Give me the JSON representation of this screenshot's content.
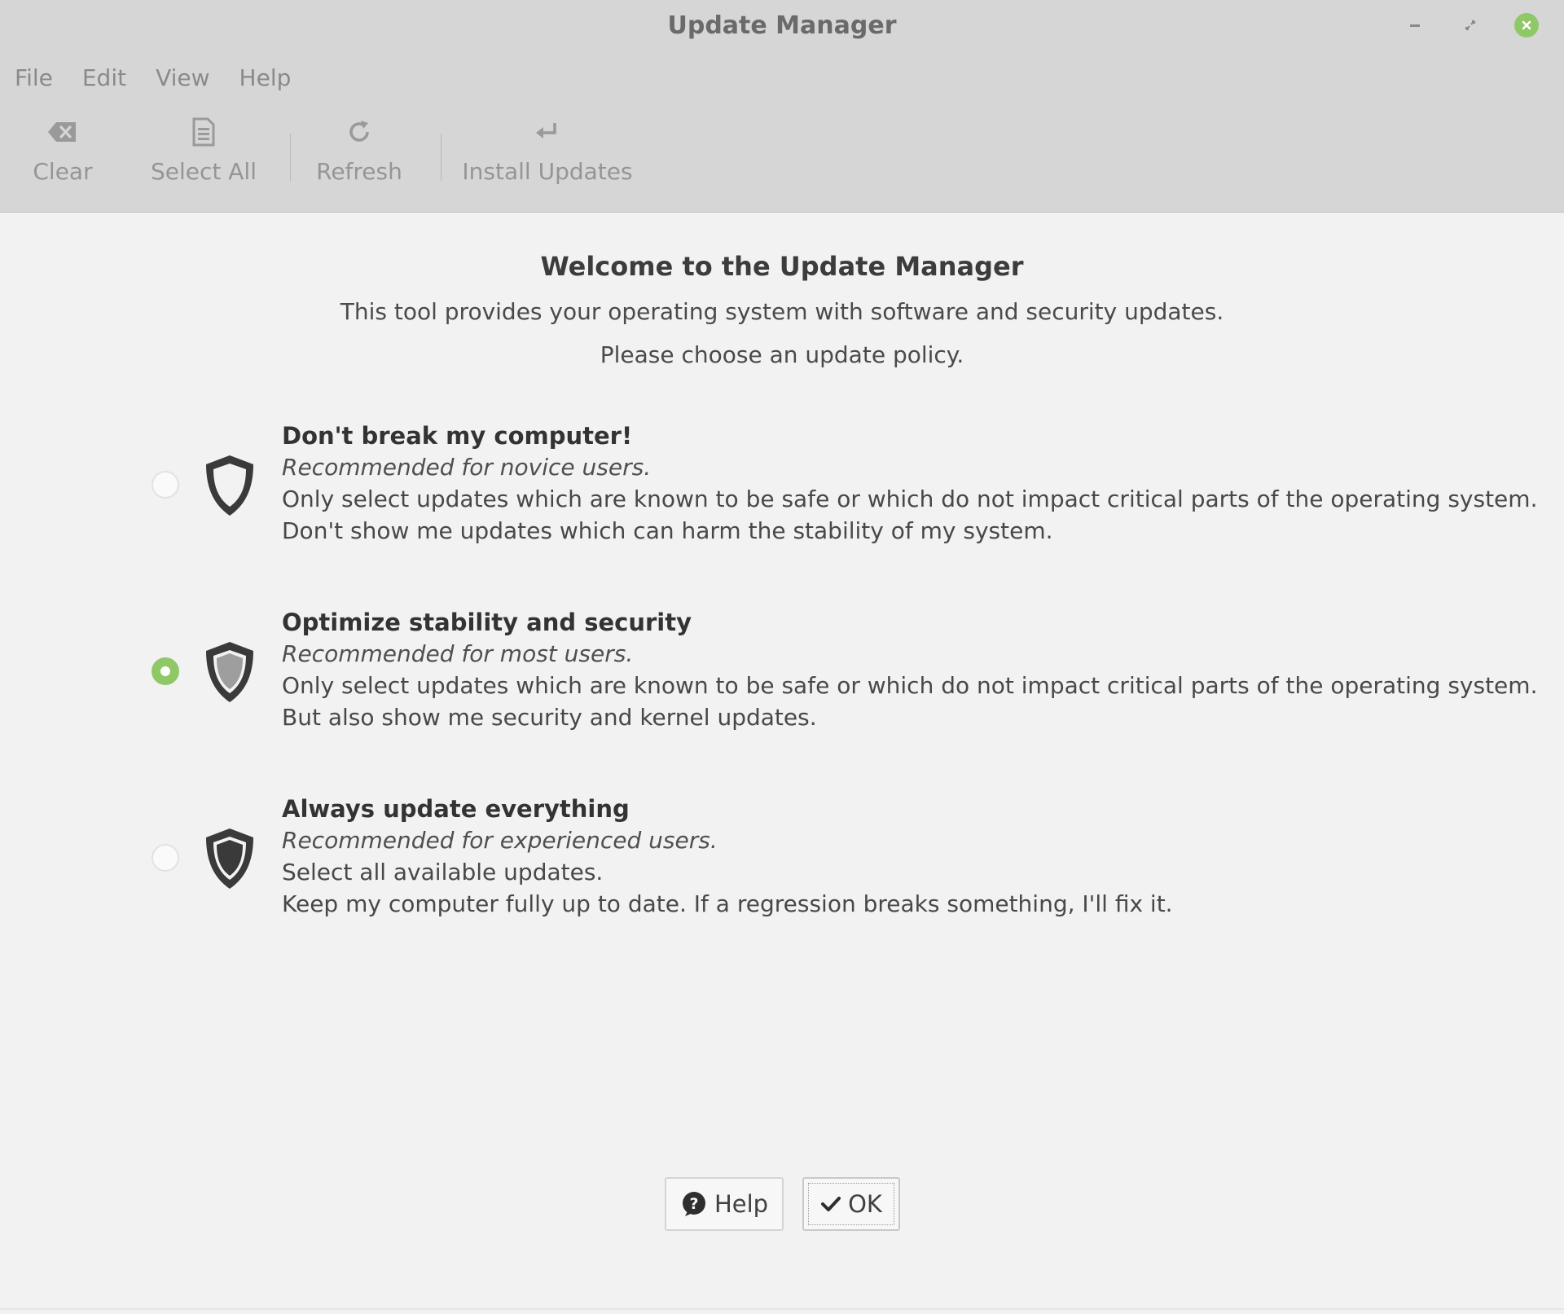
{
  "window": {
    "title": "Update Manager"
  },
  "menu": {
    "items": [
      {
        "label": "File"
      },
      {
        "label": "Edit"
      },
      {
        "label": "View"
      },
      {
        "label": "Help"
      }
    ]
  },
  "toolbar": {
    "clear": {
      "label": "Clear",
      "icon": "backspace-icon"
    },
    "select_all": {
      "label": "Select All",
      "icon": "document-icon"
    },
    "refresh": {
      "label": "Refresh",
      "icon": "refresh-icon"
    },
    "install_updates": {
      "label": "Install Updates",
      "icon": "return-arrow-icon"
    }
  },
  "welcome": {
    "title": "Welcome to the Update Manager",
    "line1": "This tool provides your operating system with software and security updates.",
    "line2": "Please choose an update policy."
  },
  "policies": [
    {
      "title": "Don't break my computer!",
      "subtitle": "Recommended for novice users.",
      "line1": "Only select updates which are known to be safe or which do not impact critical parts of the operating system.",
      "line2": "Don't show me updates which can harm the stability of my system.",
      "selected": false,
      "icon": "shield-outline-icon"
    },
    {
      "title": "Optimize stability and security",
      "subtitle": "Recommended for most users.",
      "line1": "Only select updates which are known to be safe or which do not impact critical parts of the operating system.",
      "line2": "But also show me security and kernel updates.",
      "selected": true,
      "icon": "shield-half-icon"
    },
    {
      "title": "Always update everything",
      "subtitle": "Recommended for experienced users.",
      "line1": "Select all available updates.",
      "line2": "Keep my computer fully up to date. If a regression breaks something, I'll fix it.",
      "selected": false,
      "icon": "shield-filled-icon"
    }
  ],
  "buttons": {
    "help": "Help",
    "ok": "OK"
  },
  "colors": {
    "accent": "#8fc866",
    "header_bg": "#d6d6d6",
    "content_bg": "#f2f2f2"
  }
}
